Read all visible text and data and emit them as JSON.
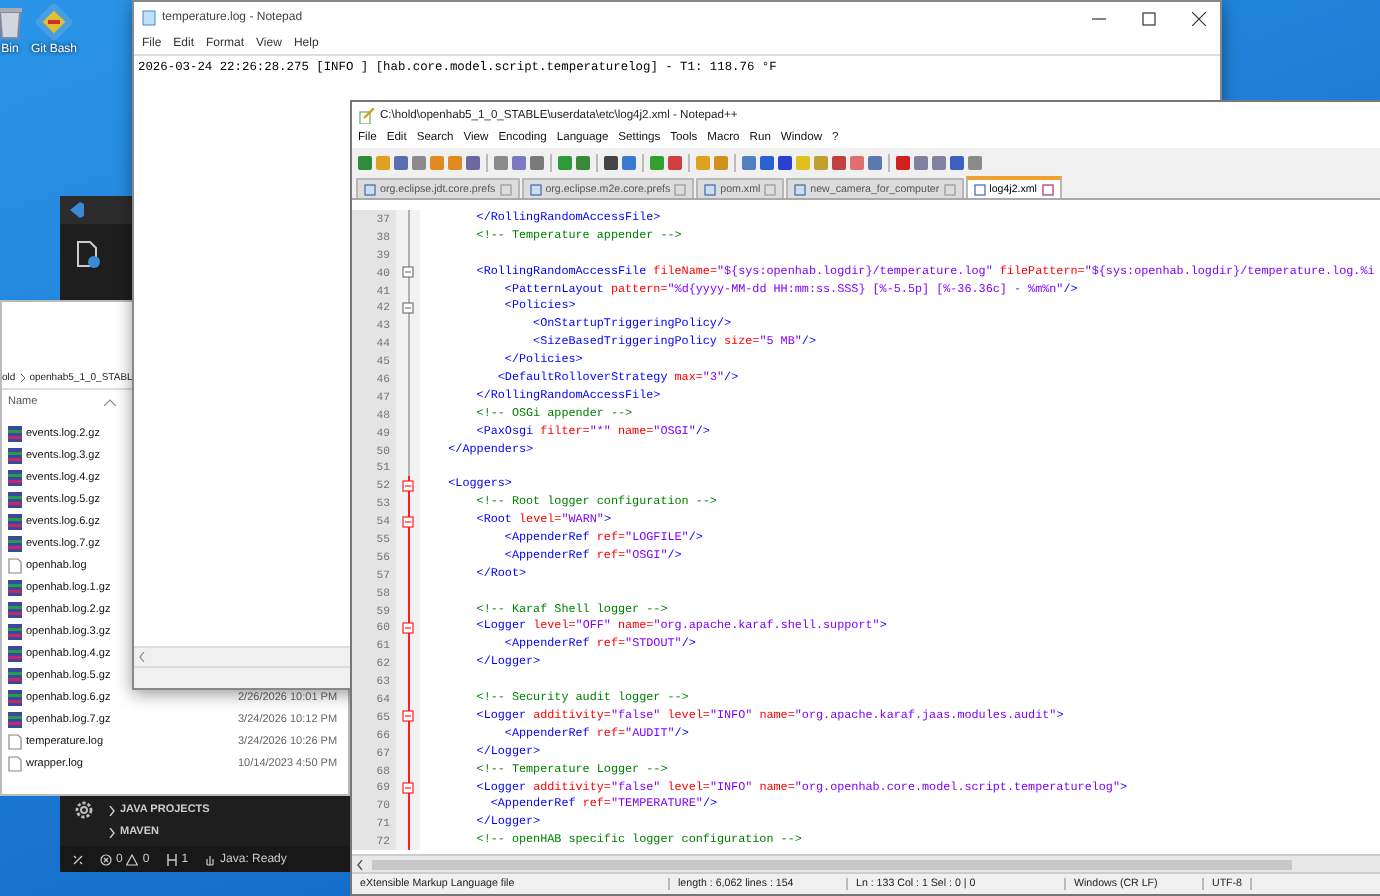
{
  "desktop_icons": [
    {
      "label": "Bin",
      "kind": "bin"
    },
    {
      "label": "Git Bash",
      "kind": "git"
    }
  ],
  "vscode": {
    "sections": [
      {
        "label": "JAVA PROJECTS",
        "expanded": false
      },
      {
        "label": "MAVEN",
        "expanded": false
      }
    ],
    "status": {
      "errors": "0",
      "warnings": "0",
      "ports": "1",
      "java": "Java: Ready"
    }
  },
  "explorer": {
    "breadcrumb": [
      "old",
      "openhab5_1_0_STABL"
    ],
    "column": "Name",
    "files": [
      {
        "name": "events.log.2.gz",
        "kind": "archive"
      },
      {
        "name": "events.log.3.gz",
        "kind": "archive"
      },
      {
        "name": "events.log.4.gz",
        "kind": "archive"
      },
      {
        "name": "events.log.5.gz",
        "kind": "archive"
      },
      {
        "name": "events.log.6.gz",
        "kind": "archive"
      },
      {
        "name": "events.log.7.gz",
        "kind": "archive"
      },
      {
        "name": "openhab.log",
        "kind": "text"
      },
      {
        "name": "openhab.log.1.gz",
        "kind": "archive"
      },
      {
        "name": "openhab.log.2.gz",
        "kind": "archive"
      },
      {
        "name": "openhab.log.3.gz",
        "kind": "archive"
      },
      {
        "name": "openhab.log.4.gz",
        "kind": "archive"
      },
      {
        "name": "openhab.log.5.gz",
        "kind": "archive"
      },
      {
        "name": "openhab.log.6.gz",
        "kind": "archive",
        "modified": "2/26/2026 10:01 PM"
      },
      {
        "name": "openhab.log.7.gz",
        "kind": "archive",
        "modified": "3/24/2026 10:12 PM"
      },
      {
        "name": "temperature.log",
        "kind": "text",
        "modified": "3/24/2026 10:26 PM"
      },
      {
        "name": "wrapper.log",
        "kind": "text",
        "modified": "10/14/2023 4:50 PM"
      }
    ]
  },
  "notepad": {
    "title": "temperature.log - Notepad",
    "menu": [
      "File",
      "Edit",
      "Format",
      "View",
      "Help"
    ],
    "content": "2026-03-24 22:26:28.275 [INFO ] [hab.core.model.script.temperaturelog] - T1: 118.76 °F"
  },
  "notepadpp": {
    "title": "C:\\hold\\openhab5_1_0_STABLE\\userdata\\etc\\log4j2.xml - Notepad++",
    "menu": [
      "File",
      "Edit",
      "Search",
      "View",
      "Encoding",
      "Language",
      "Settings",
      "Tools",
      "Macro",
      "Run",
      "Window",
      "?"
    ],
    "tabs": [
      {
        "label": "org.eclipse.jdt.core.prefs",
        "selected": false
      },
      {
        "label": "org.eclipse.m2e.core.prefs",
        "selected": false
      },
      {
        "label": "pom.xml",
        "selected": false
      },
      {
        "label": "new_camera_for_computer",
        "selected": false
      },
      {
        "label": "log4j2.xml",
        "selected": true
      }
    ],
    "lines": [
      {
        "num": "37",
        "fold": false,
        "current_fold": false,
        "tokens": [
          {
            "kind": "tag",
            "text": "        </RollingRandomAccessFile>"
          }
        ]
      },
      {
        "num": "38",
        "fold": false,
        "current_fold": false,
        "tokens": [
          {
            "kind": "comment",
            "text": "        <!-- Temperature appender -->"
          }
        ]
      },
      {
        "num": "39",
        "fold": false,
        "current_fold": false
      },
      {
        "num": "40",
        "fold": true,
        "current_fold": false,
        "tokens": [
          {
            "kind": "tag",
            "text": "        <RollingRandomAccessFile"
          },
          {
            "kind": "attr",
            "text": " fileName="
          },
          {
            "kind": "value",
            "text": "\"${sys:openhab.logdir}/temperature.log\""
          },
          {
            "kind": "attr",
            "text": " filePattern="
          },
          {
            "kind": "value",
            "text": "\"${sys:openhab.logdir}/temperature.log.%i"
          }
        ]
      },
      {
        "num": "41",
        "fold": false,
        "current_fold": false,
        "tokens": [
          {
            "kind": "tag",
            "text": "            <PatternLayout"
          },
          {
            "kind": "attr",
            "text": " pattern="
          },
          {
            "kind": "value",
            "text": "\"%d{yyyy-MM-dd HH:mm:ss.SSS} [%-5.5p] [%-36.36c] - %m%n\""
          },
          {
            "kind": "tag",
            "text": "/>"
          }
        ]
      },
      {
        "num": "42",
        "fold": true,
        "current_fold": false,
        "tokens": [
          {
            "kind": "tag",
            "text": "            <Policies>"
          }
        ]
      },
      {
        "num": "43",
        "fold": false,
        "current_fold": false,
        "tokens": [
          {
            "kind": "tag",
            "text": "                <OnStartupTriggeringPolicy/>"
          }
        ]
      },
      {
        "num": "44",
        "fold": false,
        "current_fold": false,
        "tokens": [
          {
            "kind": "tag",
            "text": "                <SizeBasedTriggeringPolicy"
          },
          {
            "kind": "attr",
            "text": " size="
          },
          {
            "kind": "value",
            "text": "\"5 MB\""
          },
          {
            "kind": "tag",
            "text": "/>"
          }
        ]
      },
      {
        "num": "45",
        "fold": false,
        "current_fold": false,
        "tokens": [
          {
            "kind": "tag",
            "text": "            </Policies>"
          }
        ]
      },
      {
        "num": "46",
        "fold": false,
        "current_fold": false,
        "tokens": [
          {
            "kind": "tag",
            "text": "           <DefaultRolloverStrategy"
          },
          {
            "kind": "attr",
            "text": " max="
          },
          {
            "kind": "value",
            "text": "\"3\""
          },
          {
            "kind": "tag",
            "text": "/>"
          }
        ]
      },
      {
        "num": "47",
        "fold": false,
        "current_fold": false,
        "tokens": [
          {
            "kind": "tag",
            "text": "        </RollingRandomAccessFile>"
          }
        ]
      },
      {
        "num": "48",
        "fold": false,
        "current_fold": false,
        "tokens": [
          {
            "kind": "comment",
            "text": "        <!-- OSGi appender -->"
          }
        ]
      },
      {
        "num": "49",
        "fold": false,
        "current_fold": false,
        "tokens": [
          {
            "kind": "tag",
            "text": "        <PaxOsgi"
          },
          {
            "kind": "attr",
            "text": " filter="
          },
          {
            "kind": "value",
            "text": "\"*\""
          },
          {
            "kind": "attr",
            "text": " name="
          },
          {
            "kind": "value",
            "text": "\"OSGI\""
          },
          {
            "kind": "tag",
            "text": "/>"
          }
        ]
      },
      {
        "num": "50",
        "fold": false,
        "current_fold": false,
        "tokens": [
          {
            "kind": "tag",
            "text": "    </Appenders>"
          }
        ]
      },
      {
        "num": "51",
        "fold": false,
        "current_fold": false
      },
      {
        "num": "52",
        "fold": true,
        "current_fold": true,
        "tokens": [
          {
            "kind": "tag",
            "text": "    <Loggers>"
          }
        ]
      },
      {
        "num": "53",
        "fold": false,
        "current_fold": true,
        "tokens": [
          {
            "kind": "comment",
            "text": "        <!-- Root logger configuration -->"
          }
        ]
      },
      {
        "num": "54",
        "fold": true,
        "current_fold": true,
        "tokens": [
          {
            "kind": "tag",
            "text": "        <Root"
          },
          {
            "kind": "attr",
            "text": " level="
          },
          {
            "kind": "value",
            "text": "\"WARN\""
          },
          {
            "kind": "tag",
            "text": ">"
          }
        ]
      },
      {
        "num": "55",
        "fold": false,
        "current_fold": true,
        "tokens": [
          {
            "kind": "tag",
            "text": "            <AppenderRef"
          },
          {
            "kind": "attr",
            "text": " ref="
          },
          {
            "kind": "value",
            "text": "\"LOGFILE\""
          },
          {
            "kind": "tag",
            "text": "/>"
          }
        ]
      },
      {
        "num": "56",
        "fold": false,
        "current_fold": true,
        "tokens": [
          {
            "kind": "tag",
            "text": "            <AppenderRef"
          },
          {
            "kind": "attr",
            "text": " ref="
          },
          {
            "kind": "value",
            "text": "\"OSGI\""
          },
          {
            "kind": "tag",
            "text": "/>"
          }
        ]
      },
      {
        "num": "57",
        "fold": false,
        "current_fold": true,
        "tokens": [
          {
            "kind": "tag",
            "text": "        </Root>"
          }
        ]
      },
      {
        "num": "58",
        "fold": false,
        "current_fold": true
      },
      {
        "num": "59",
        "fold": false,
        "current_fold": true,
        "tokens": [
          {
            "kind": "comment",
            "text": "        <!-- Karaf Shell logger -->"
          }
        ]
      },
      {
        "num": "60",
        "fold": true,
        "current_fold": true,
        "tokens": [
          {
            "kind": "tag",
            "text": "        <Logger"
          },
          {
            "kind": "attr",
            "text": " level="
          },
          {
            "kind": "value",
            "text": "\"OFF\""
          },
          {
            "kind": "attr",
            "text": " name="
          },
          {
            "kind": "value",
            "text": "\"org.apache.karaf.shell.support\""
          },
          {
            "kind": "tag",
            "text": ">"
          }
        ]
      },
      {
        "num": "61",
        "fold": false,
        "current_fold": true,
        "tokens": [
          {
            "kind": "tag",
            "text": "            <AppenderRef"
          },
          {
            "kind": "attr",
            "text": " ref="
          },
          {
            "kind": "value",
            "text": "\"STDOUT\""
          },
          {
            "kind": "tag",
            "text": "/>"
          }
        ]
      },
      {
        "num": "62",
        "fold": false,
        "current_fold": true,
        "tokens": [
          {
            "kind": "tag",
            "text": "        </Logger>"
          }
        ]
      },
      {
        "num": "63",
        "fold": false,
        "current_fold": true
      },
      {
        "num": "64",
        "fold": false,
        "current_fold": true,
        "tokens": [
          {
            "kind": "comment",
            "text": "        <!-- Security audit logger -->"
          }
        ]
      },
      {
        "num": "65",
        "fold": true,
        "current_fold": true,
        "tokens": [
          {
            "kind": "tag",
            "text": "        <Logger"
          },
          {
            "kind": "attr",
            "text": " additivity="
          },
          {
            "kind": "value",
            "text": "\"false\""
          },
          {
            "kind": "attr",
            "text": " level="
          },
          {
            "kind": "value",
            "text": "\"INFO\""
          },
          {
            "kind": "attr",
            "text": " name="
          },
          {
            "kind": "value",
            "text": "\"org.apache.karaf.jaas.modules.audit\""
          },
          {
            "kind": "tag",
            "text": ">"
          }
        ]
      },
      {
        "num": "66",
        "fold": false,
        "current_fold": true,
        "tokens": [
          {
            "kind": "tag",
            "text": "            <AppenderRef"
          },
          {
            "kind": "attr",
            "text": " ref="
          },
          {
            "kind": "value",
            "text": "\"AUDIT\""
          },
          {
            "kind": "tag",
            "text": "/>"
          }
        ]
      },
      {
        "num": "67",
        "fold": false,
        "current_fold": true,
        "tokens": [
          {
            "kind": "tag",
            "text": "        </Logger>"
          }
        ]
      },
      {
        "num": "68",
        "fold": false,
        "current_fold": true,
        "tokens": [
          {
            "kind": "comment",
            "text": "        <!-- Temperature Logger -->"
          }
        ]
      },
      {
        "num": "69",
        "fold": true,
        "current_fold": true,
        "tokens": [
          {
            "kind": "tag",
            "text": "        <Logger"
          },
          {
            "kind": "attr",
            "text": " additivity="
          },
          {
            "kind": "value",
            "text": "\"false\""
          },
          {
            "kind": "attr",
            "text": " level="
          },
          {
            "kind": "value",
            "text": "\"INFO\""
          },
          {
            "kind": "attr",
            "text": " name="
          },
          {
            "kind": "value",
            "text": "\"org.openhab.core.model.script.temperaturelog\""
          },
          {
            "kind": "tag",
            "text": ">"
          }
        ]
      },
      {
        "num": "70",
        "fold": false,
        "current_fold": true,
        "tokens": [
          {
            "kind": "tag",
            "text": "          <AppenderRef"
          },
          {
            "kind": "attr",
            "text": " ref="
          },
          {
            "kind": "value",
            "text": "\"TEMPERATURE\""
          },
          {
            "kind": "tag",
            "text": "/>"
          }
        ]
      },
      {
        "num": "71",
        "fold": false,
        "current_fold": true,
        "tokens": [
          {
            "kind": "tag",
            "text": "        </Logger>"
          }
        ]
      },
      {
        "num": "72",
        "fold": false,
        "current_fold": true,
        "tokens": [
          {
            "kind": "comment",
            "text": "        <!-- openHAB specific logger configuration -->"
          }
        ]
      }
    ],
    "status_bar": [
      "eXtensible Markup Language file",
      "length : 6,062    lines : 154",
      "Ln : 133    Col : 1    Sel : 0 | 0",
      "Windows (CR LF)",
      "UTF-8"
    ]
  }
}
